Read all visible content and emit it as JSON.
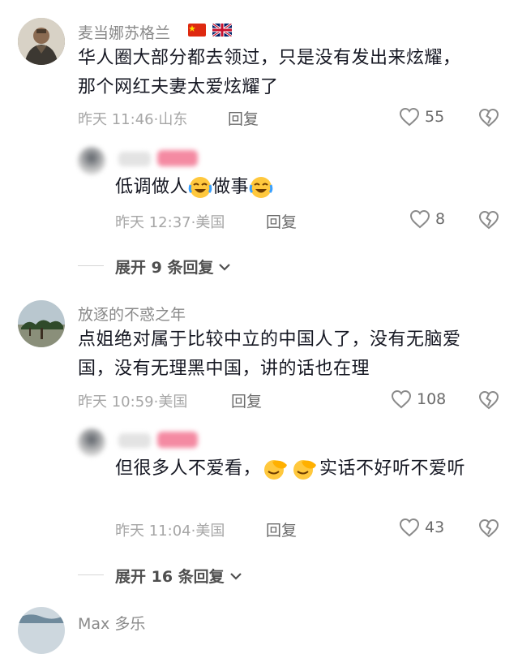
{
  "comments": [
    {
      "username": "麦当娜苏格兰",
      "flags": [
        "flag-china-icon",
        "flag-uk-icon"
      ],
      "text": "华人圈大部分都去领过，只是没有发出来炫耀，那个网红夫妻太爱炫耀了",
      "time": "昨天 11:46",
      "location": "山东",
      "reply_label": "回复",
      "likes": "55",
      "replies": [
        {
          "text_parts": [
            "低调做人",
            "做事"
          ],
          "time": "昨天 12:37",
          "location": "美国",
          "reply_label": "回复",
          "likes": "8"
        }
      ],
      "expand_label": "展开 9 条回复"
    },
    {
      "username": "放逐的不惑之年",
      "text": "点姐绝对属于比较中立的中国人了，没有无脑爱国，没有无理黑中国，讲的话也在理",
      "time": "昨天 10:59",
      "location": "美国",
      "reply_label": "回复",
      "likes": "108",
      "replies": [
        {
          "text_parts": [
            "但很多人不爱看，",
            "实话不好听不爱听"
          ],
          "time": "昨天 11:04",
          "location": "美国",
          "reply_label": "回复",
          "likes": "43"
        }
      ],
      "expand_label": "展开 16 条回复"
    },
    {
      "username": "Max 多乐"
    }
  ],
  "colors": {
    "username": "#8a8a8a",
    "text": "#161823",
    "meta": "#a6a6a6",
    "accent_pink": "#f06a8a"
  }
}
